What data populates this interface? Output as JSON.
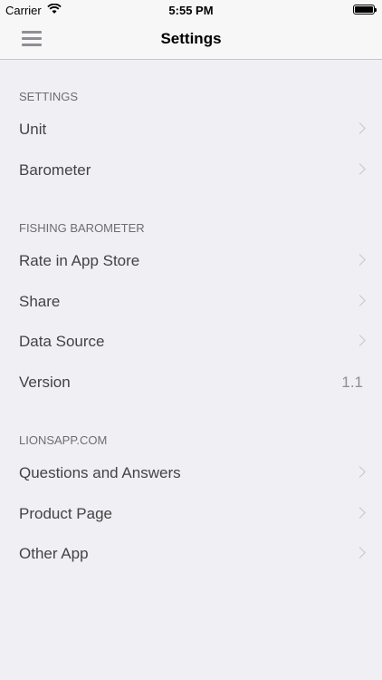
{
  "status_bar": {
    "carrier": "Carrier",
    "time": "5:55 PM"
  },
  "nav": {
    "title": "Settings",
    "menu_icon": "hamburger-menu-icon"
  },
  "sections": [
    {
      "header": "SETTINGS",
      "rows": [
        {
          "label": "Unit",
          "accessory": "chevron"
        },
        {
          "label": "Barometer",
          "accessory": "chevron"
        }
      ]
    },
    {
      "header": "FISHING BAROMETER",
      "rows": [
        {
          "label": "Rate in App Store",
          "accessory": "chevron"
        },
        {
          "label": "Share",
          "accessory": "chevron"
        },
        {
          "label": "Data Source",
          "accessory": "chevron"
        },
        {
          "label": "Version",
          "detail": "1.1"
        }
      ]
    },
    {
      "header": "LIONSAPP.COM",
      "rows": [
        {
          "label": "Questions and Answers",
          "accessory": "chevron"
        },
        {
          "label": "Product Page",
          "accessory": "chevron"
        },
        {
          "label": "Other App",
          "accessory": "chevron"
        }
      ]
    }
  ]
}
